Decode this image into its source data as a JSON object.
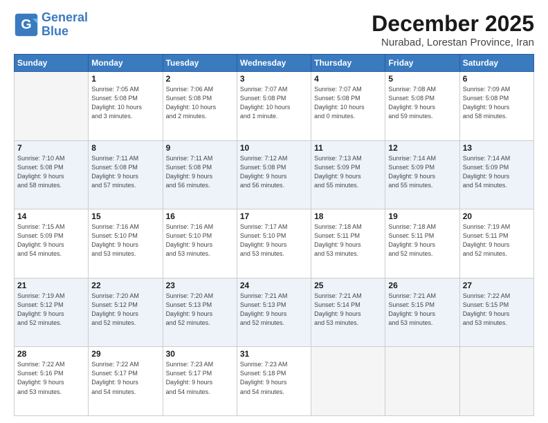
{
  "logo": {
    "line1": "General",
    "line2": "Blue"
  },
  "header": {
    "month": "December 2025",
    "location": "Nurabad, Lorestan Province, Iran"
  },
  "weekdays": [
    "Sunday",
    "Monday",
    "Tuesday",
    "Wednesday",
    "Thursday",
    "Friday",
    "Saturday"
  ],
  "weeks": [
    [
      {
        "day": "",
        "info": ""
      },
      {
        "day": "1",
        "info": "Sunrise: 7:05 AM\nSunset: 5:08 PM\nDaylight: 10 hours\nand 3 minutes."
      },
      {
        "day": "2",
        "info": "Sunrise: 7:06 AM\nSunset: 5:08 PM\nDaylight: 10 hours\nand 2 minutes."
      },
      {
        "day": "3",
        "info": "Sunrise: 7:07 AM\nSunset: 5:08 PM\nDaylight: 10 hours\nand 1 minute."
      },
      {
        "day": "4",
        "info": "Sunrise: 7:07 AM\nSunset: 5:08 PM\nDaylight: 10 hours\nand 0 minutes."
      },
      {
        "day": "5",
        "info": "Sunrise: 7:08 AM\nSunset: 5:08 PM\nDaylight: 9 hours\nand 59 minutes."
      },
      {
        "day": "6",
        "info": "Sunrise: 7:09 AM\nSunset: 5:08 PM\nDaylight: 9 hours\nand 58 minutes."
      }
    ],
    [
      {
        "day": "7",
        "info": "Sunrise: 7:10 AM\nSunset: 5:08 PM\nDaylight: 9 hours\nand 58 minutes."
      },
      {
        "day": "8",
        "info": "Sunrise: 7:11 AM\nSunset: 5:08 PM\nDaylight: 9 hours\nand 57 minutes."
      },
      {
        "day": "9",
        "info": "Sunrise: 7:11 AM\nSunset: 5:08 PM\nDaylight: 9 hours\nand 56 minutes."
      },
      {
        "day": "10",
        "info": "Sunrise: 7:12 AM\nSunset: 5:08 PM\nDaylight: 9 hours\nand 56 minutes."
      },
      {
        "day": "11",
        "info": "Sunrise: 7:13 AM\nSunset: 5:09 PM\nDaylight: 9 hours\nand 55 minutes."
      },
      {
        "day": "12",
        "info": "Sunrise: 7:14 AM\nSunset: 5:09 PM\nDaylight: 9 hours\nand 55 minutes."
      },
      {
        "day": "13",
        "info": "Sunrise: 7:14 AM\nSunset: 5:09 PM\nDaylight: 9 hours\nand 54 minutes."
      }
    ],
    [
      {
        "day": "14",
        "info": "Sunrise: 7:15 AM\nSunset: 5:09 PM\nDaylight: 9 hours\nand 54 minutes."
      },
      {
        "day": "15",
        "info": "Sunrise: 7:16 AM\nSunset: 5:10 PM\nDaylight: 9 hours\nand 53 minutes."
      },
      {
        "day": "16",
        "info": "Sunrise: 7:16 AM\nSunset: 5:10 PM\nDaylight: 9 hours\nand 53 minutes."
      },
      {
        "day": "17",
        "info": "Sunrise: 7:17 AM\nSunset: 5:10 PM\nDaylight: 9 hours\nand 53 minutes."
      },
      {
        "day": "18",
        "info": "Sunrise: 7:18 AM\nSunset: 5:11 PM\nDaylight: 9 hours\nand 53 minutes."
      },
      {
        "day": "19",
        "info": "Sunrise: 7:18 AM\nSunset: 5:11 PM\nDaylight: 9 hours\nand 52 minutes."
      },
      {
        "day": "20",
        "info": "Sunrise: 7:19 AM\nSunset: 5:11 PM\nDaylight: 9 hours\nand 52 minutes."
      }
    ],
    [
      {
        "day": "21",
        "info": "Sunrise: 7:19 AM\nSunset: 5:12 PM\nDaylight: 9 hours\nand 52 minutes."
      },
      {
        "day": "22",
        "info": "Sunrise: 7:20 AM\nSunset: 5:12 PM\nDaylight: 9 hours\nand 52 minutes."
      },
      {
        "day": "23",
        "info": "Sunrise: 7:20 AM\nSunset: 5:13 PM\nDaylight: 9 hours\nand 52 minutes."
      },
      {
        "day": "24",
        "info": "Sunrise: 7:21 AM\nSunset: 5:13 PM\nDaylight: 9 hours\nand 52 minutes."
      },
      {
        "day": "25",
        "info": "Sunrise: 7:21 AM\nSunset: 5:14 PM\nDaylight: 9 hours\nand 53 minutes."
      },
      {
        "day": "26",
        "info": "Sunrise: 7:21 AM\nSunset: 5:15 PM\nDaylight: 9 hours\nand 53 minutes."
      },
      {
        "day": "27",
        "info": "Sunrise: 7:22 AM\nSunset: 5:15 PM\nDaylight: 9 hours\nand 53 minutes."
      }
    ],
    [
      {
        "day": "28",
        "info": "Sunrise: 7:22 AM\nSunset: 5:16 PM\nDaylight: 9 hours\nand 53 minutes."
      },
      {
        "day": "29",
        "info": "Sunrise: 7:22 AM\nSunset: 5:17 PM\nDaylight: 9 hours\nand 54 minutes."
      },
      {
        "day": "30",
        "info": "Sunrise: 7:23 AM\nSunset: 5:17 PM\nDaylight: 9 hours\nand 54 minutes."
      },
      {
        "day": "31",
        "info": "Sunrise: 7:23 AM\nSunset: 5:18 PM\nDaylight: 9 hours\nand 54 minutes."
      },
      {
        "day": "",
        "info": ""
      },
      {
        "day": "",
        "info": ""
      },
      {
        "day": "",
        "info": ""
      }
    ]
  ]
}
